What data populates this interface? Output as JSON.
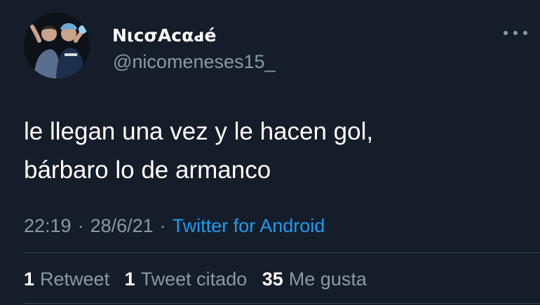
{
  "author": {
    "display_name": "NιcσAcαԁé",
    "handle": "@nicomeneses15_"
  },
  "tweet": {
    "lines": [
      "le llegan una vez y le hacen gol,",
      "bárbaro lo de armanco"
    ]
  },
  "meta": {
    "time": "22:19",
    "separator": "·",
    "date": "28/6/21",
    "source": "Twitter for Android"
  },
  "stats": {
    "retweets": {
      "count": "1",
      "label": "Retweet"
    },
    "quotes": {
      "count": "1",
      "label": "Tweet citado"
    },
    "likes": {
      "count": "35",
      "label": "Me gusta"
    }
  },
  "colors": {
    "background": "#141d29",
    "primary_text": "#ffffff",
    "secondary_text": "#8b98a5",
    "link": "#1d9bf0",
    "divider": "#38444d"
  },
  "icons": {
    "more": "more-horizontal-icon"
  }
}
